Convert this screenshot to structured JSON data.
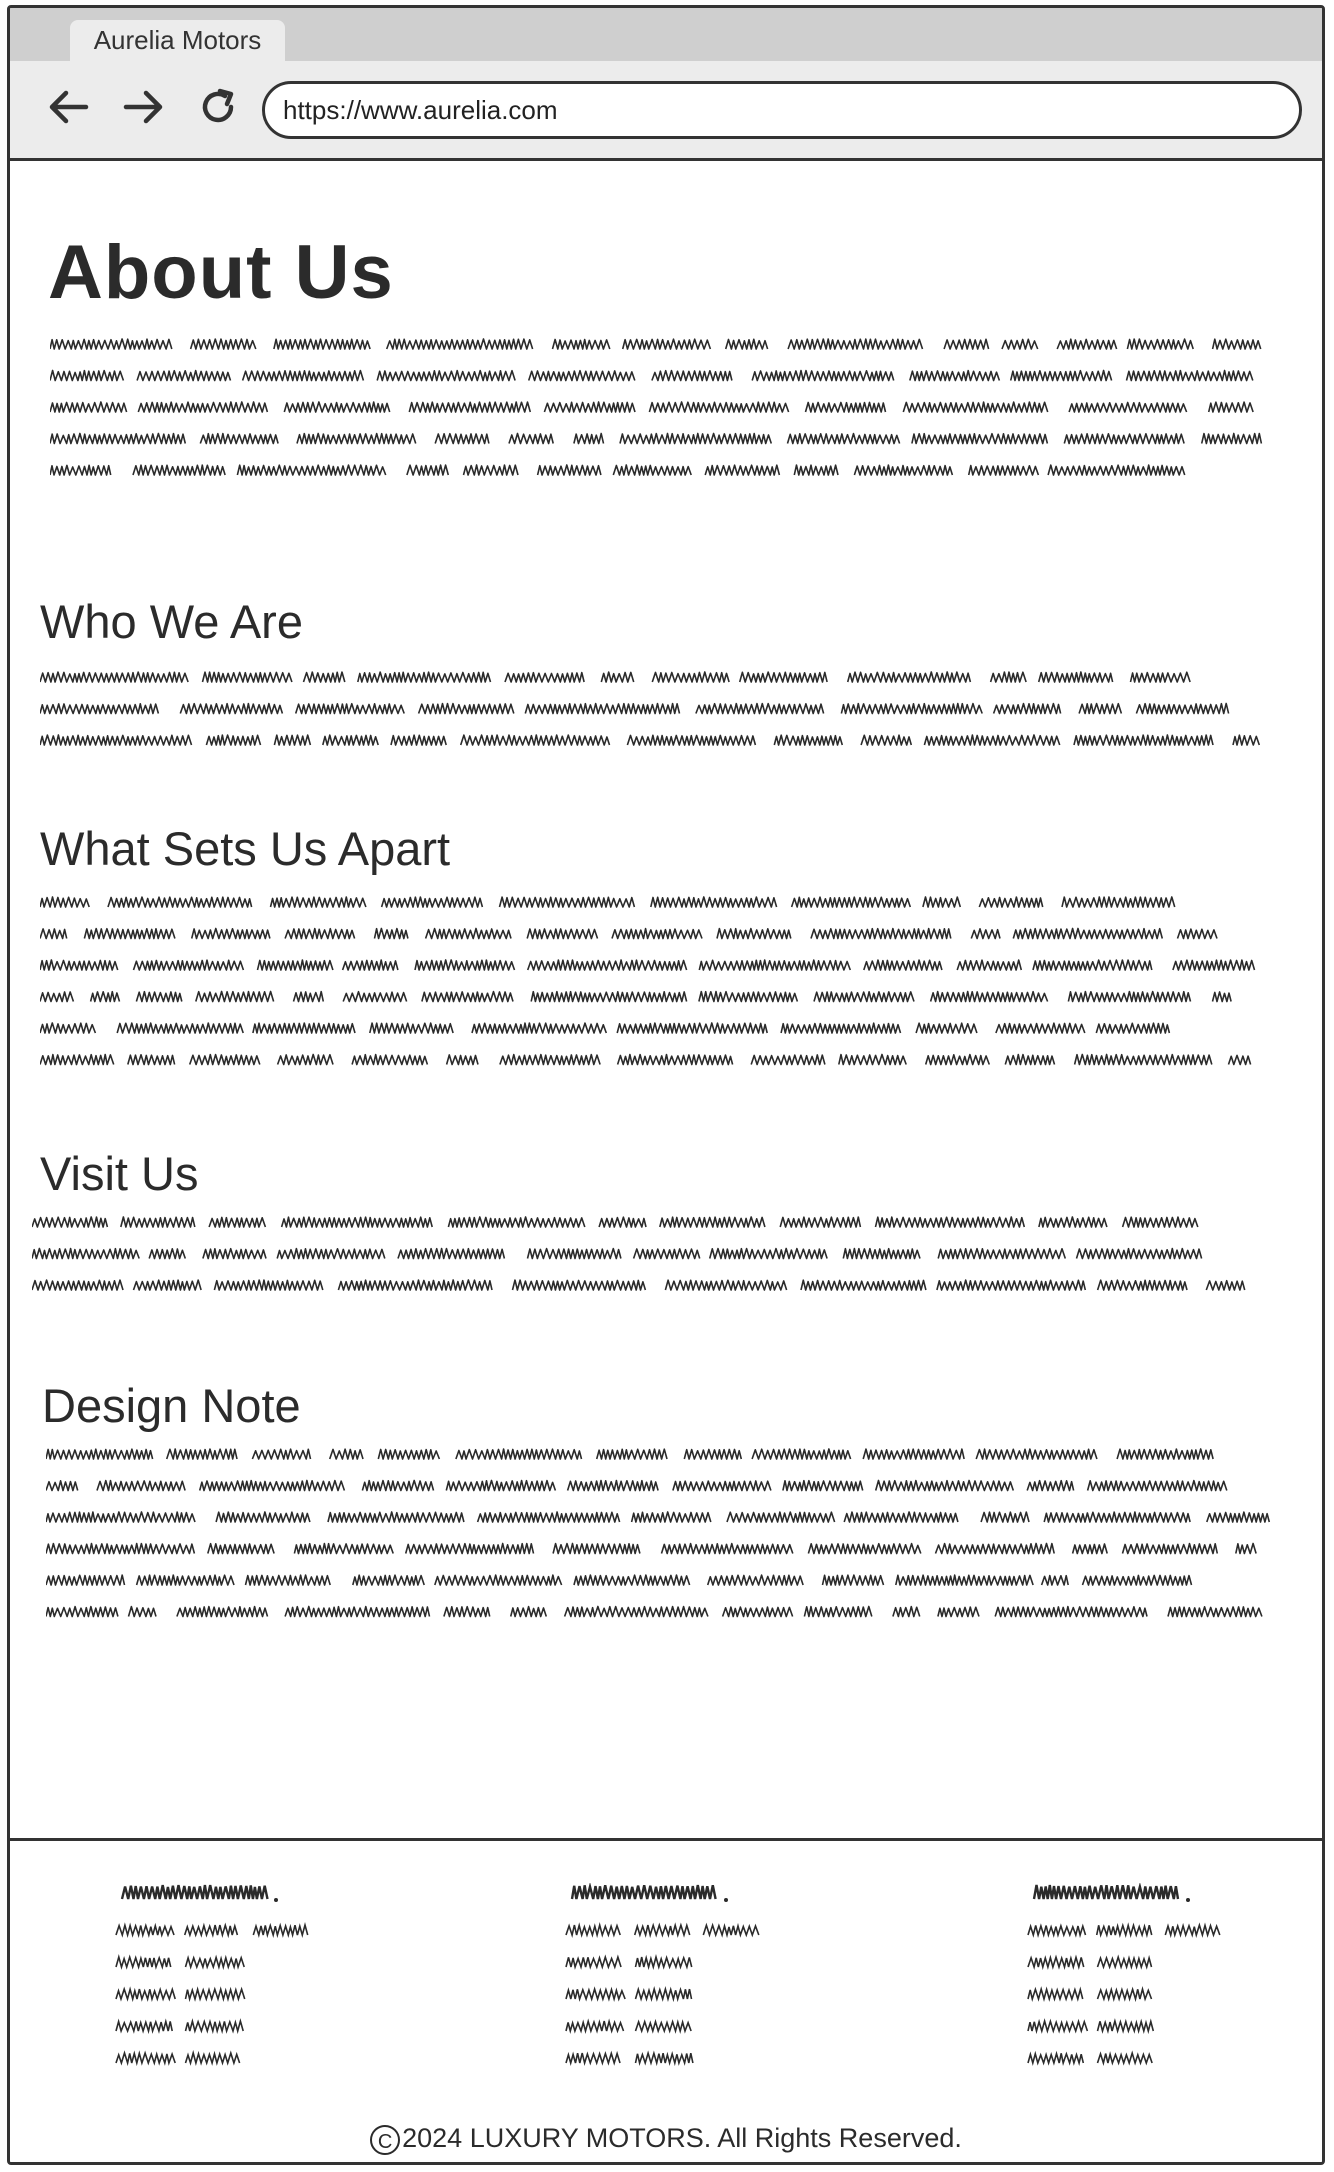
{
  "browser": {
    "tab_title": "Aurelia Motors",
    "url": "https://www.aurelia.com"
  },
  "page": {
    "title": "About Us",
    "sections": [
      {
        "heading": "Who We Are"
      },
      {
        "heading": "What Sets Us Apart"
      },
      {
        "heading": "Visit Us"
      },
      {
        "heading": "Design Note"
      }
    ]
  },
  "footer": {
    "copyright_year_text": "2024 LUXURY MOTORS. All Rights Reserved.",
    "copyright_symbol": "C"
  },
  "icons": {
    "back": "arrow-left-icon",
    "forward": "arrow-right-icon",
    "reload": "reload-icon"
  },
  "colors": {
    "ink": "#2b2b2b",
    "chrome": "#ececec",
    "tabstrip": "#cfcfcf"
  }
}
